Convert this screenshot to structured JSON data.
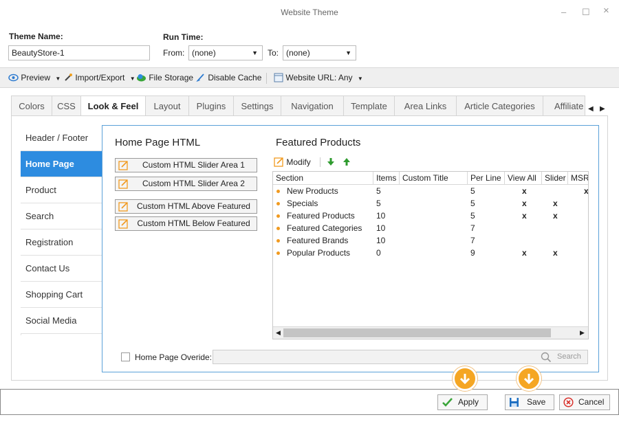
{
  "window": {
    "title": "Website Theme",
    "controls": {
      "minimize": "–",
      "maximize": "☐",
      "close": "×"
    }
  },
  "form": {
    "theme_name_label": "Theme Name:",
    "theme_name_value": "BeautyStore-1",
    "run_time_label": "Run Time:",
    "from_label": "From:",
    "from_value": "(none)",
    "to_label": "To:",
    "to_value": "(none)"
  },
  "toolbar": {
    "preview": "Preview",
    "import_export": "Import/Export",
    "file_storage": "File Storage",
    "disable_cache": "Disable Cache",
    "website_url": "Website URL: Any"
  },
  "tabs": [
    {
      "label": "Colors"
    },
    {
      "label": "CSS"
    },
    {
      "label": "Look & Feel"
    },
    {
      "label": "Layout"
    },
    {
      "label": "Plugins"
    },
    {
      "label": "Settings"
    },
    {
      "label": "Navigation"
    },
    {
      "label": "Template"
    },
    {
      "label": "Area Links"
    },
    {
      "label": "Article Categories"
    },
    {
      "label": "Affiliate"
    }
  ],
  "sidebar": {
    "items": [
      {
        "label": "Header / Footer"
      },
      {
        "label": "Home Page"
      },
      {
        "label": "Product"
      },
      {
        "label": "Search"
      },
      {
        "label": "Registration"
      },
      {
        "label": "Contact Us"
      },
      {
        "label": "Shopping Cart"
      },
      {
        "label": "Social Media"
      }
    ]
  },
  "home_html": {
    "title": "Home Page HTML",
    "buttons": [
      {
        "label": "Custom HTML Slider Area 1"
      },
      {
        "label": "Custom HTML Slider Area 2"
      },
      {
        "label": "Custom HTML Above Featured"
      },
      {
        "label": "Custom HTML Below Featured"
      }
    ]
  },
  "featured": {
    "title": "Featured Products",
    "modify_label": "Modify",
    "columns": [
      "Section",
      "Items",
      "Custom Title",
      "Per Line",
      "View All",
      "Slider",
      "MSR"
    ],
    "rows": [
      {
        "section": "New Products",
        "items": "5",
        "custom_title": "",
        "per_line": "5",
        "view_all": "x",
        "slider": "",
        "msr": "x"
      },
      {
        "section": "Specials",
        "items": "5",
        "custom_title": "",
        "per_line": "5",
        "view_all": "x",
        "slider": "x",
        "msr": ""
      },
      {
        "section": "Featured Products",
        "items": "10",
        "custom_title": "",
        "per_line": "5",
        "view_all": "x",
        "slider": "x",
        "msr": ""
      },
      {
        "section": "Featured Categories",
        "items": "10",
        "custom_title": "",
        "per_line": "7",
        "view_all": "",
        "slider": "",
        "msr": ""
      },
      {
        "section": "Featured Brands",
        "items": "10",
        "custom_title": "",
        "per_line": "7",
        "view_all": "",
        "slider": "",
        "msr": ""
      },
      {
        "section": "Popular Products",
        "items": "0",
        "custom_title": "",
        "per_line": "9",
        "view_all": "x",
        "slider": "x",
        "msr": ""
      }
    ]
  },
  "override": {
    "label": "Home Page Overide:",
    "search_placeholder": "Search"
  },
  "footer": {
    "apply": "Apply",
    "save": "Save",
    "cancel": "Cancel"
  },
  "colors": {
    "accent": "#2d8ce0",
    "panel_border": "#5aa0d8",
    "bullet": "#f19a1f",
    "callout": "#f5a623",
    "apply_check": "#3aa53a",
    "cancel_red": "#d9312b"
  }
}
